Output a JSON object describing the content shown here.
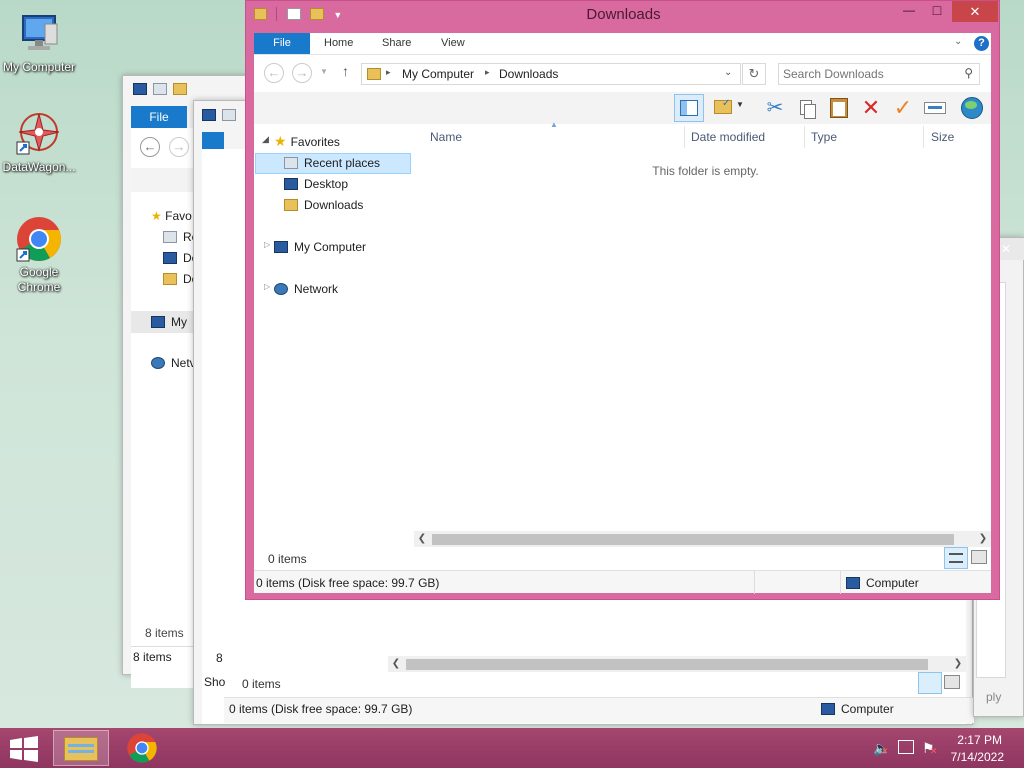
{
  "desktop": {
    "icons": [
      {
        "label": "My Computer"
      },
      {
        "label": "DataWagon..."
      },
      {
        "label": "Google Chrome"
      }
    ]
  },
  "bg_window_1": {
    "file_tab": "File",
    "tree": [
      "Favo",
      "Re",
      "De",
      "Do",
      "My",
      "Netv"
    ],
    "items_count": "8 items",
    "status": "8 items"
  },
  "bg_window_2": {
    "tree_partial": "Sho",
    "status_count": "8",
    "items_count": "0 items",
    "status": "0 items (Disk free space: 99.7 GB)",
    "computer": "Computer",
    "apply_partial": "ply"
  },
  "window": {
    "title": "Downloads",
    "controls": {
      "minimize": "—",
      "maximize": "□",
      "close": "✕"
    },
    "ribbon": {
      "tabs": [
        {
          "label": "File"
        },
        {
          "label": "Home"
        },
        {
          "label": "Share"
        },
        {
          "label": "View"
        }
      ],
      "help": "?"
    },
    "address": {
      "crumbs": [
        "My Computer",
        "Downloads"
      ],
      "search_placeholder": "Search Downloads"
    },
    "nav": {
      "favorites": "Favorites",
      "recent": "Recent places",
      "desktop": "Desktop",
      "downloads": "Downloads",
      "computer": "My Computer",
      "network": "Network"
    },
    "columns": [
      "Name",
      "Date modified",
      "Type",
      "Size"
    ],
    "empty_message": "This folder is empty.",
    "items_count": "0 items",
    "status": "0 items (Disk free space: 99.7 GB)",
    "status_location": "Computer"
  },
  "taskbar": {
    "time": "2:17 PM",
    "date": "7/14/2022"
  },
  "colors": {
    "accent": "#1979ca",
    "window_frame": "#d86aa0",
    "taskbar": "#9a3e68",
    "selection": "#cce8ff"
  }
}
